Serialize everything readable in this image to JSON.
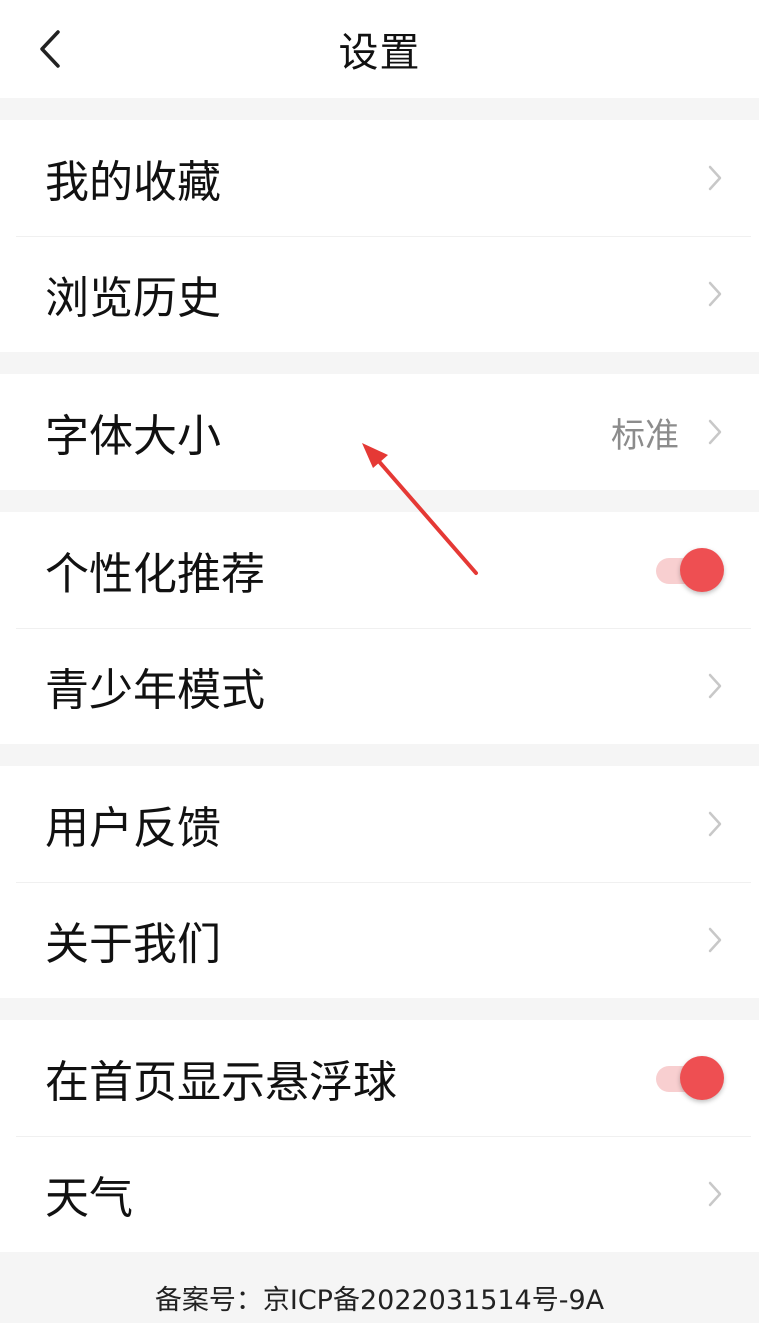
{
  "header": {
    "title": "设置",
    "back_icon": "chevron-left-icon"
  },
  "groups": [
    {
      "items": [
        {
          "label": "我的收藏",
          "type": "nav"
        },
        {
          "label": "浏览历史",
          "type": "nav"
        }
      ]
    },
    {
      "items": [
        {
          "label": "字体大小",
          "type": "nav",
          "value": "标准"
        }
      ]
    },
    {
      "items": [
        {
          "label": "个性化推荐",
          "type": "toggle",
          "on": true
        },
        {
          "label": "青少年模式",
          "type": "nav"
        }
      ]
    },
    {
      "items": [
        {
          "label": "用户反馈",
          "type": "nav"
        },
        {
          "label": "关于我们",
          "type": "nav"
        }
      ]
    },
    {
      "items": [
        {
          "label": "在首页显示悬浮球",
          "type": "toggle",
          "on": true
        },
        {
          "label": "天气",
          "type": "nav"
        }
      ]
    }
  ],
  "footer": {
    "icp": "备案号：京ICP备2022031514号-9A"
  },
  "colors": {
    "accent": "#ee4f52",
    "track": "#f8cfd0",
    "chevron": "#c8c8c8",
    "annotation_arrow": "#e53935"
  }
}
